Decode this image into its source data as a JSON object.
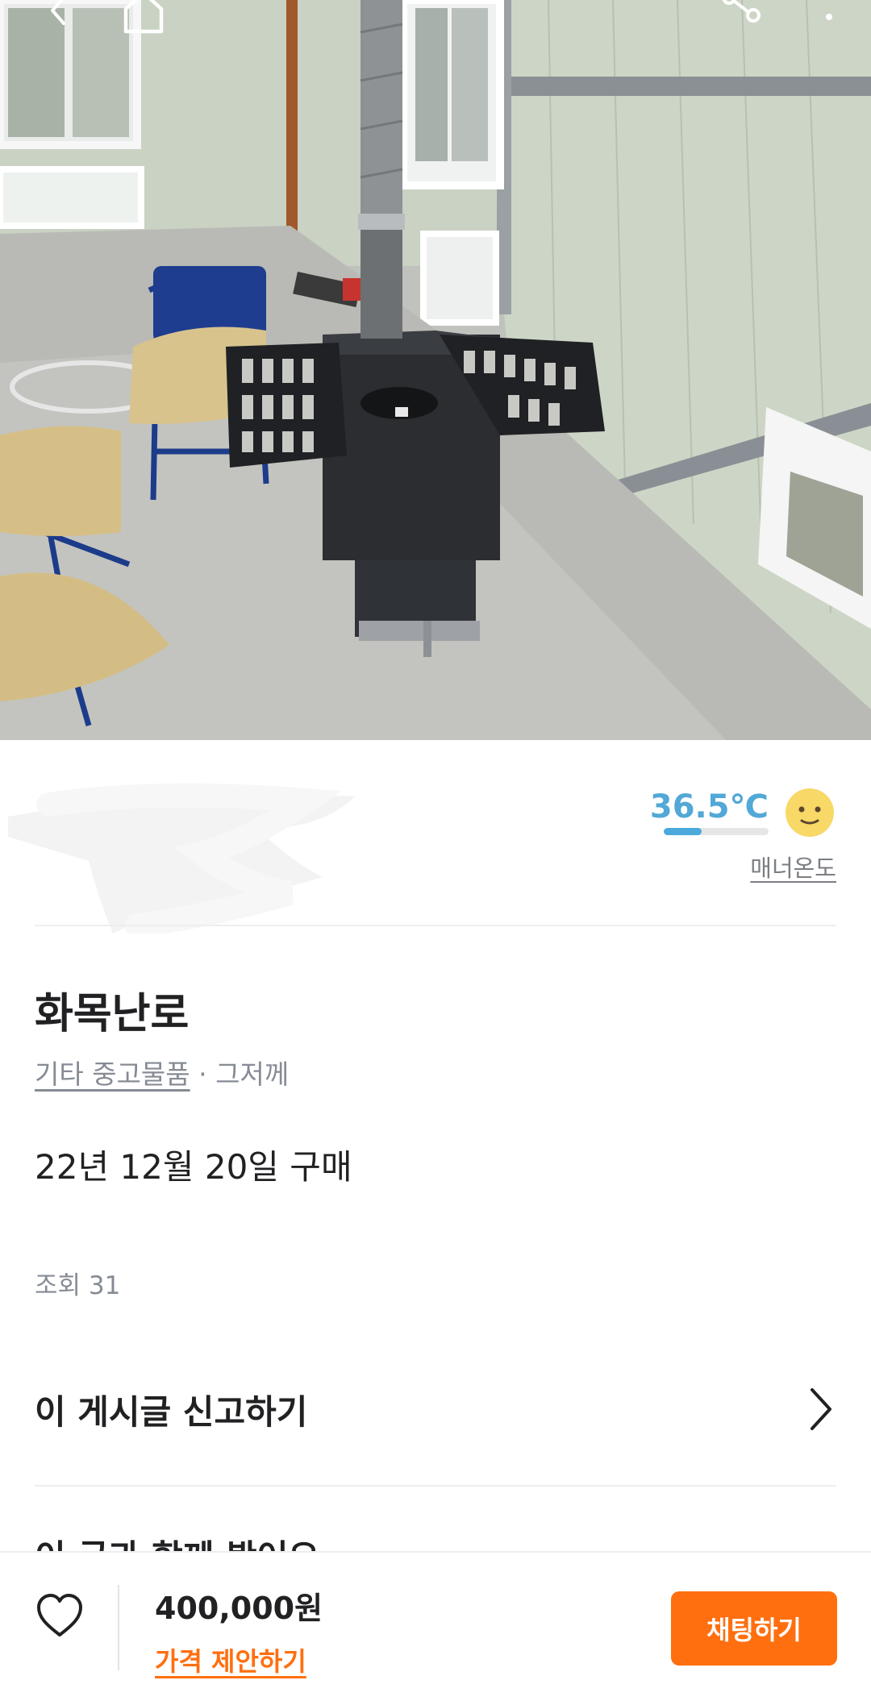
{
  "seller": {
    "temperature": "36.5℃",
    "temperature_level": 0.365,
    "manner_label": "매너온도"
  },
  "article": {
    "title": "화목난로",
    "category": "기타 중고물품",
    "meta_separator": " · ",
    "posted": "그저께",
    "description": "22년 12월 20일 구매",
    "views": "조회 31",
    "report_label": "이 게시글 신고하기",
    "next_section_partial": "이 글과 함께 봤어요"
  },
  "bottom_bar": {
    "price": "400,000원",
    "offer_label": "가격 제안하기",
    "chat_button": "채팅하기"
  },
  "colors": {
    "brand_orange": "#ff6f0f",
    "temperature_blue": "#4ba9db"
  },
  "icons": {
    "back": "back-arrow-icon",
    "home": "home-icon",
    "share": "share-icon",
    "more": "more-vertical-icon",
    "heart": "heart-icon",
    "chevron": "chevron-right-icon",
    "temperature_face": "smile-face-icon"
  }
}
